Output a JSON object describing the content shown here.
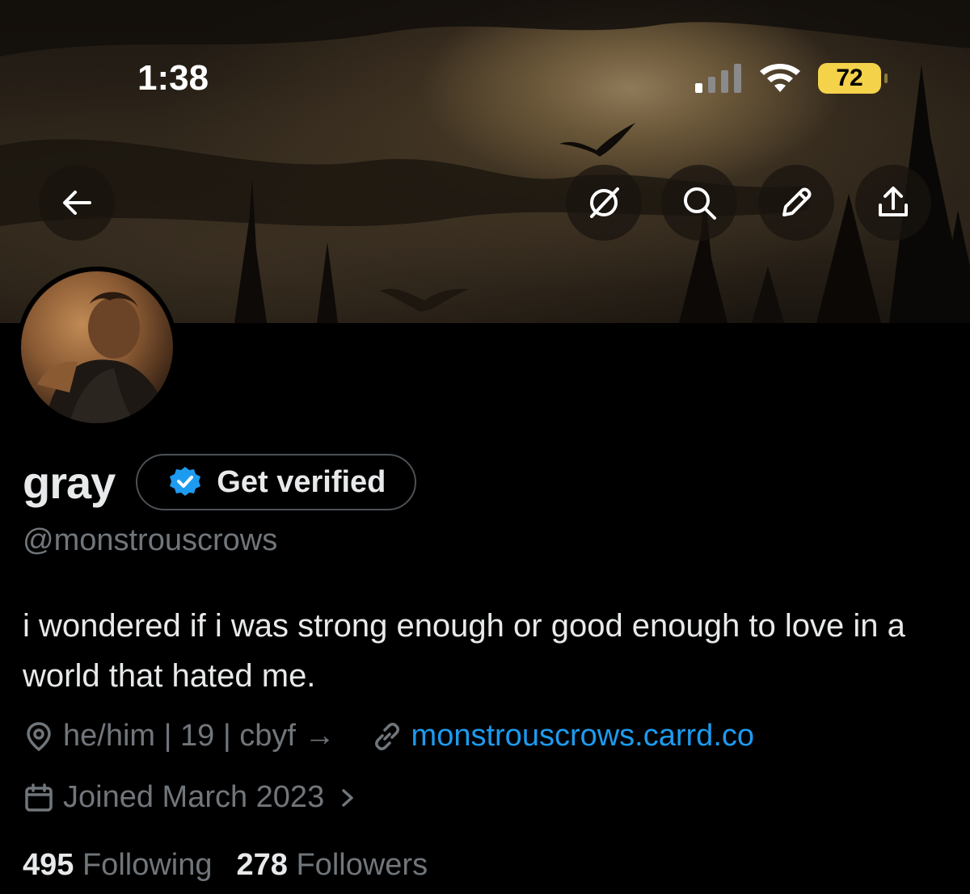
{
  "status_bar": {
    "time": "1:38",
    "battery": "72",
    "icons": [
      "cellular-signal-icon",
      "wifi-icon",
      "battery-icon"
    ]
  },
  "header": {
    "buttons": [
      "back-arrow-icon",
      "grok-icon",
      "search-icon",
      "pencil-icon",
      "share-icon"
    ]
  },
  "profile": {
    "name": "gray",
    "get_verified_label": "Get verified",
    "handle": "@monstrouscrows",
    "bio": "i wondered if i was strong enough or good enough to love in a world that hated me.",
    "location": "he/him | 19 | cbyf →",
    "website": "monstrouscrows.carrd.co",
    "joined": "Joined March 2023"
  },
  "stats": {
    "following_count": "495",
    "following_label": "Following",
    "followers_count": "278",
    "followers_label": "Followers"
  },
  "colors": {
    "background": "#000000",
    "text_primary": "#e7e9ea",
    "text_secondary": "#71767b",
    "link": "#1d9bf0",
    "verified_badge": "#1d9bf0",
    "battery": "#f4d24a"
  }
}
